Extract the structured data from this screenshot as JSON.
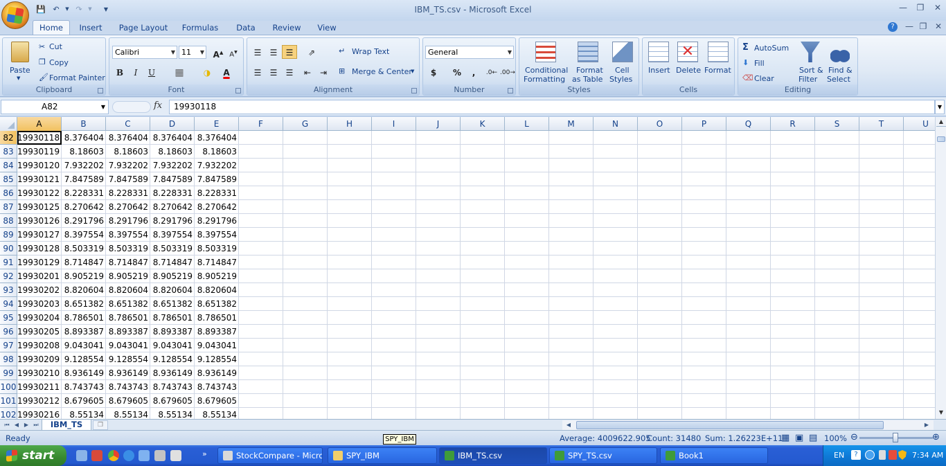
{
  "window": {
    "title": "IBM_TS.csv - Microsoft Excel"
  },
  "ribbon_tabs": [
    "Home",
    "Insert",
    "Page Layout",
    "Formulas",
    "Data",
    "Review",
    "View"
  ],
  "clipboard": {
    "paste": "Paste",
    "cut": "Cut",
    "copy": "Copy",
    "format_painter": "Format Painter",
    "label": "Clipboard"
  },
  "font": {
    "name": "Calibri",
    "size": "11",
    "bold": "B",
    "italic": "I",
    "underline": "U",
    "label": "Font"
  },
  "alignment": {
    "wrap_text": "Wrap Text",
    "merge_center": "Merge & Center",
    "label": "Alignment"
  },
  "number": {
    "format": "General",
    "currency": "$",
    "percent": "%",
    "comma": ",",
    "label": "Number"
  },
  "styles": {
    "conditional_1": "Conditional",
    "conditional_2": "Formatting",
    "format_table_1": "Format",
    "format_table_2": "as Table",
    "cell_styles_1": "Cell",
    "cell_styles_2": "Styles",
    "label": "Styles"
  },
  "cells": {
    "insert": "Insert",
    "delete": "Delete",
    "format": "Format",
    "label": "Cells"
  },
  "editing": {
    "autosum": "AutoSum",
    "fill": "Fill",
    "clear": "Clear",
    "sort_1": "Sort &",
    "sort_2": "Filter",
    "find_1": "Find &",
    "find_2": "Select",
    "label": "Editing"
  },
  "formula_bar": {
    "name_box": "A82",
    "fx": "fx",
    "value": "19930118"
  },
  "columns": [
    "A",
    "B",
    "C",
    "D",
    "E",
    "F",
    "G",
    "H",
    "I",
    "J",
    "K",
    "L",
    "M",
    "N",
    "O",
    "P",
    "Q",
    "R",
    "S",
    "T",
    "U"
  ],
  "rows": [
    {
      "n": "82",
      "a": "19930118",
      "v": [
        "8.376404",
        "8.376404",
        "8.376404",
        "8.376404"
      ]
    },
    {
      "n": "83",
      "a": "19930119",
      "v": [
        "8.18603",
        "8.18603",
        "8.18603",
        "8.18603"
      ]
    },
    {
      "n": "84",
      "a": "19930120",
      "v": [
        "7.932202",
        "7.932202",
        "7.932202",
        "7.932202"
      ]
    },
    {
      "n": "85",
      "a": "19930121",
      "v": [
        "7.847589",
        "7.847589",
        "7.847589",
        "7.847589"
      ]
    },
    {
      "n": "86",
      "a": "19930122",
      "v": [
        "8.228331",
        "8.228331",
        "8.228331",
        "8.228331"
      ]
    },
    {
      "n": "87",
      "a": "19930125",
      "v": [
        "8.270642",
        "8.270642",
        "8.270642",
        "8.270642"
      ]
    },
    {
      "n": "88",
      "a": "19930126",
      "v": [
        "8.291796",
        "8.291796",
        "8.291796",
        "8.291796"
      ]
    },
    {
      "n": "89",
      "a": "19930127",
      "v": [
        "8.397554",
        "8.397554",
        "8.397554",
        "8.397554"
      ]
    },
    {
      "n": "90",
      "a": "19930128",
      "v": [
        "8.503319",
        "8.503319",
        "8.503319",
        "8.503319"
      ]
    },
    {
      "n": "91",
      "a": "19930129",
      "v": [
        "8.714847",
        "8.714847",
        "8.714847",
        "8.714847"
      ]
    },
    {
      "n": "92",
      "a": "19930201",
      "v": [
        "8.905219",
        "8.905219",
        "8.905219",
        "8.905219"
      ]
    },
    {
      "n": "93",
      "a": "19930202",
      "v": [
        "8.820604",
        "8.820604",
        "8.820604",
        "8.820604"
      ]
    },
    {
      "n": "94",
      "a": "19930203",
      "v": [
        "8.651382",
        "8.651382",
        "8.651382",
        "8.651382"
      ]
    },
    {
      "n": "95",
      "a": "19930204",
      "v": [
        "8.786501",
        "8.786501",
        "8.786501",
        "8.786501"
      ]
    },
    {
      "n": "96",
      "a": "19930205",
      "v": [
        "8.893387",
        "8.893387",
        "8.893387",
        "8.893387"
      ]
    },
    {
      "n": "97",
      "a": "19930208",
      "v": [
        "9.043041",
        "9.043041",
        "9.043041",
        "9.043041"
      ]
    },
    {
      "n": "98",
      "a": "19930209",
      "v": [
        "9.128554",
        "9.128554",
        "9.128554",
        "9.128554"
      ]
    },
    {
      "n": "99",
      "a": "19930210",
      "v": [
        "8.936149",
        "8.936149",
        "8.936149",
        "8.936149"
      ]
    },
    {
      "n": "100",
      "a": "19930211",
      "v": [
        "8.743743",
        "8.743743",
        "8.743743",
        "8.743743"
      ]
    },
    {
      "n": "101",
      "a": "19930212",
      "v": [
        "8.679605",
        "8.679605",
        "8.679605",
        "8.679605"
      ]
    },
    {
      "n": "102",
      "a": "19930216",
      "v": [
        "8.55134",
        "8.55134",
        "8.55134",
        "8.55134"
      ]
    }
  ],
  "sheet_tab": "IBM_TS",
  "status": {
    "ready": "Ready",
    "average": "Average: 4009622.905",
    "count": "Count: 31480",
    "sum": "Sum: 1.26223E+11",
    "zoom": "100%",
    "tooltip": "SPY_IBM"
  },
  "taskbar": {
    "start": "start",
    "tasks": [
      "StockCompare - Micro...",
      "SPY_IBM",
      "IBM_TS.csv",
      "SPY_TS.csv",
      "Book1"
    ],
    "lang": "EN",
    "clock": "7:34 AM"
  },
  "colors": {
    "accent": "#15428b",
    "selected_header": "#f1c15f",
    "taskbar": "#245ad0",
    "start": "#37892f"
  }
}
